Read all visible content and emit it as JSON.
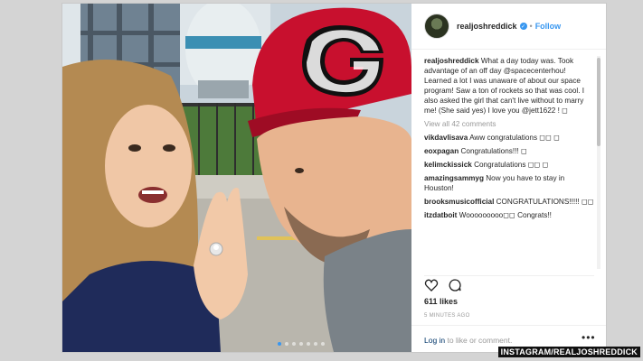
{
  "post": {
    "username": "realjoshreddick",
    "follow_label": "Follow",
    "separator": "•",
    "caption_user": "realjoshreddick",
    "caption_text": "What a day today was. Took advantage of an off day @spacecenterhou! Learned a lot I was unaware of about our space program! Saw a ton of rockets so that was cool. I also asked the girl that can't live without to marry me! (She said yes) I love you @jett1622 ! ◻",
    "view_all": "View all 42 comments",
    "comments": [
      {
        "user": "vikdavlisava",
        "text": "Aww congratulations ◻◻ ◻"
      },
      {
        "user": "eoxpagan",
        "text": "Congratulations!!! ◻"
      },
      {
        "user": "kelimckissick",
        "text": "Congratulations ◻◻ ◻"
      },
      {
        "user": "amazingsammyg",
        "text": "Now you have to stay in Houston!"
      },
      {
        "user": "brooksmusicofficial",
        "text": "CONGRATULATIONS!!!!! ◻◻"
      },
      {
        "user": "itzdatboit",
        "text": "Wooooooooo◻◻ Congrats!!"
      }
    ],
    "likes": "611 likes",
    "time": "5 MINUTES AGO",
    "login_link": "Log in",
    "login_rest": " to like or comment.",
    "more": "•••"
  },
  "carousel": {
    "count": 7,
    "active": 0
  },
  "icons": [
    "heart-icon",
    "comment-icon",
    "verified-icon",
    "more-icon"
  ],
  "colors": {
    "accent": "#3897f0",
    "text": "#262626",
    "muted": "#999999",
    "cap_red": "#c8102e"
  },
  "watermark": "INSTAGRAM/REALJOSHREDDICK"
}
